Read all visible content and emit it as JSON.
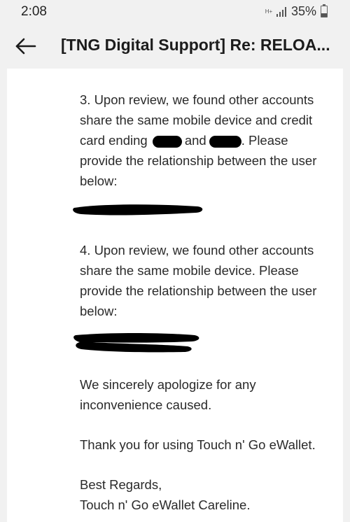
{
  "status_bar": {
    "time": "2:08",
    "network_type": "H+",
    "battery_percent": "35%",
    "battery_level": 0.35
  },
  "app_bar": {
    "back_icon": "arrow-left-icon",
    "title": "[TNG Digital Support] Re: RELOA..."
  },
  "email": {
    "item3": {
      "line1": "3. Upon review, we found other accounts",
      "line2": "share the same mobile device and credit",
      "line3_a": "card ending",
      "line3_b": "and",
      "line3_c": ". Please",
      "line4": "provide the relationship between the user",
      "line5": "below:"
    },
    "item4": {
      "line1": "4. Upon review, we found other accounts",
      "line2": "share the same mobile device. Please",
      "line3": "provide the relationship between the user",
      "line4": "below:"
    },
    "apology": {
      "line1": "We sincerely apologize for any",
      "line2": "inconvenience caused."
    },
    "thanks": "Thank you for using Touch n' Go eWallet.",
    "signoff": {
      "line1": "Best Regards,",
      "line2": "Touch n' Go eWallet Careline."
    }
  }
}
